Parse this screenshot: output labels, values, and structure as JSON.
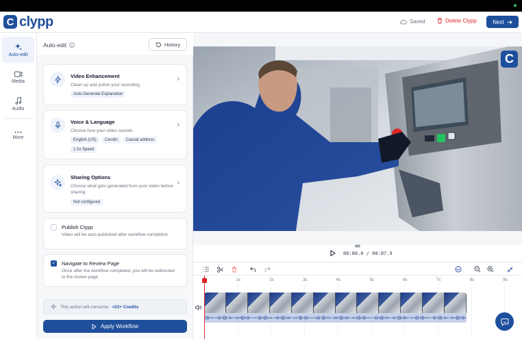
{
  "app": {
    "logo_letter": "C",
    "name": "clypp"
  },
  "header": {
    "saved_label": "Saved",
    "delete_label": "Delete Clypp",
    "next_label": "Next"
  },
  "rail": [
    {
      "label": "Auto-edit",
      "icon": "sparkle-icon",
      "active": true
    },
    {
      "label": "Media",
      "icon": "video-camera-icon"
    },
    {
      "label": "Audio",
      "icon": "music-note-icon"
    },
    {
      "label": "More",
      "icon": "more-dots-icon"
    }
  ],
  "panel": {
    "title": "Auto-edit",
    "history_label": "History",
    "cards": [
      {
        "title": "Video Enhancement",
        "subtitle": "Clean up and polish your recording",
        "chips": [
          "Auto-Generate Explanation"
        ],
        "icon": "lightning-icon"
      },
      {
        "title": "Voice & Language",
        "subtitle": "Choose how your video sounds",
        "chips": [
          "English (US)",
          "Carolin",
          "Casual address",
          "1.0x Speed"
        ],
        "icon": "microphone-icon"
      },
      {
        "title": "Sharing Options",
        "subtitle": "Choose what gets generated from your video before sharing",
        "chips": [
          "Not configured"
        ],
        "icon": "sparkle-icon"
      }
    ],
    "options": [
      {
        "title": "Publish Clypp",
        "subtitle": "Video will be auto published after workflow completion",
        "checked": false
      },
      {
        "title": "Navigate to Review Page",
        "subtitle": "Once after the workflow completed, you will be redirected to the review page",
        "checked": true
      }
    ],
    "credits_prefix": "This action will consume",
    "credits_value": "≈23+ Credits",
    "apply_label": "Apply Workflow"
  },
  "player": {
    "current": "00:00.0",
    "separator": "/",
    "total": "00:07.9"
  },
  "timeline": {
    "ticks": [
      "0",
      "1s",
      "2s",
      "3s",
      "4s",
      "5s",
      "6s",
      "7s",
      "8s",
      "9s"
    ]
  },
  "colors": {
    "brand": "#1e4f9c",
    "danger": "#dc2626"
  }
}
